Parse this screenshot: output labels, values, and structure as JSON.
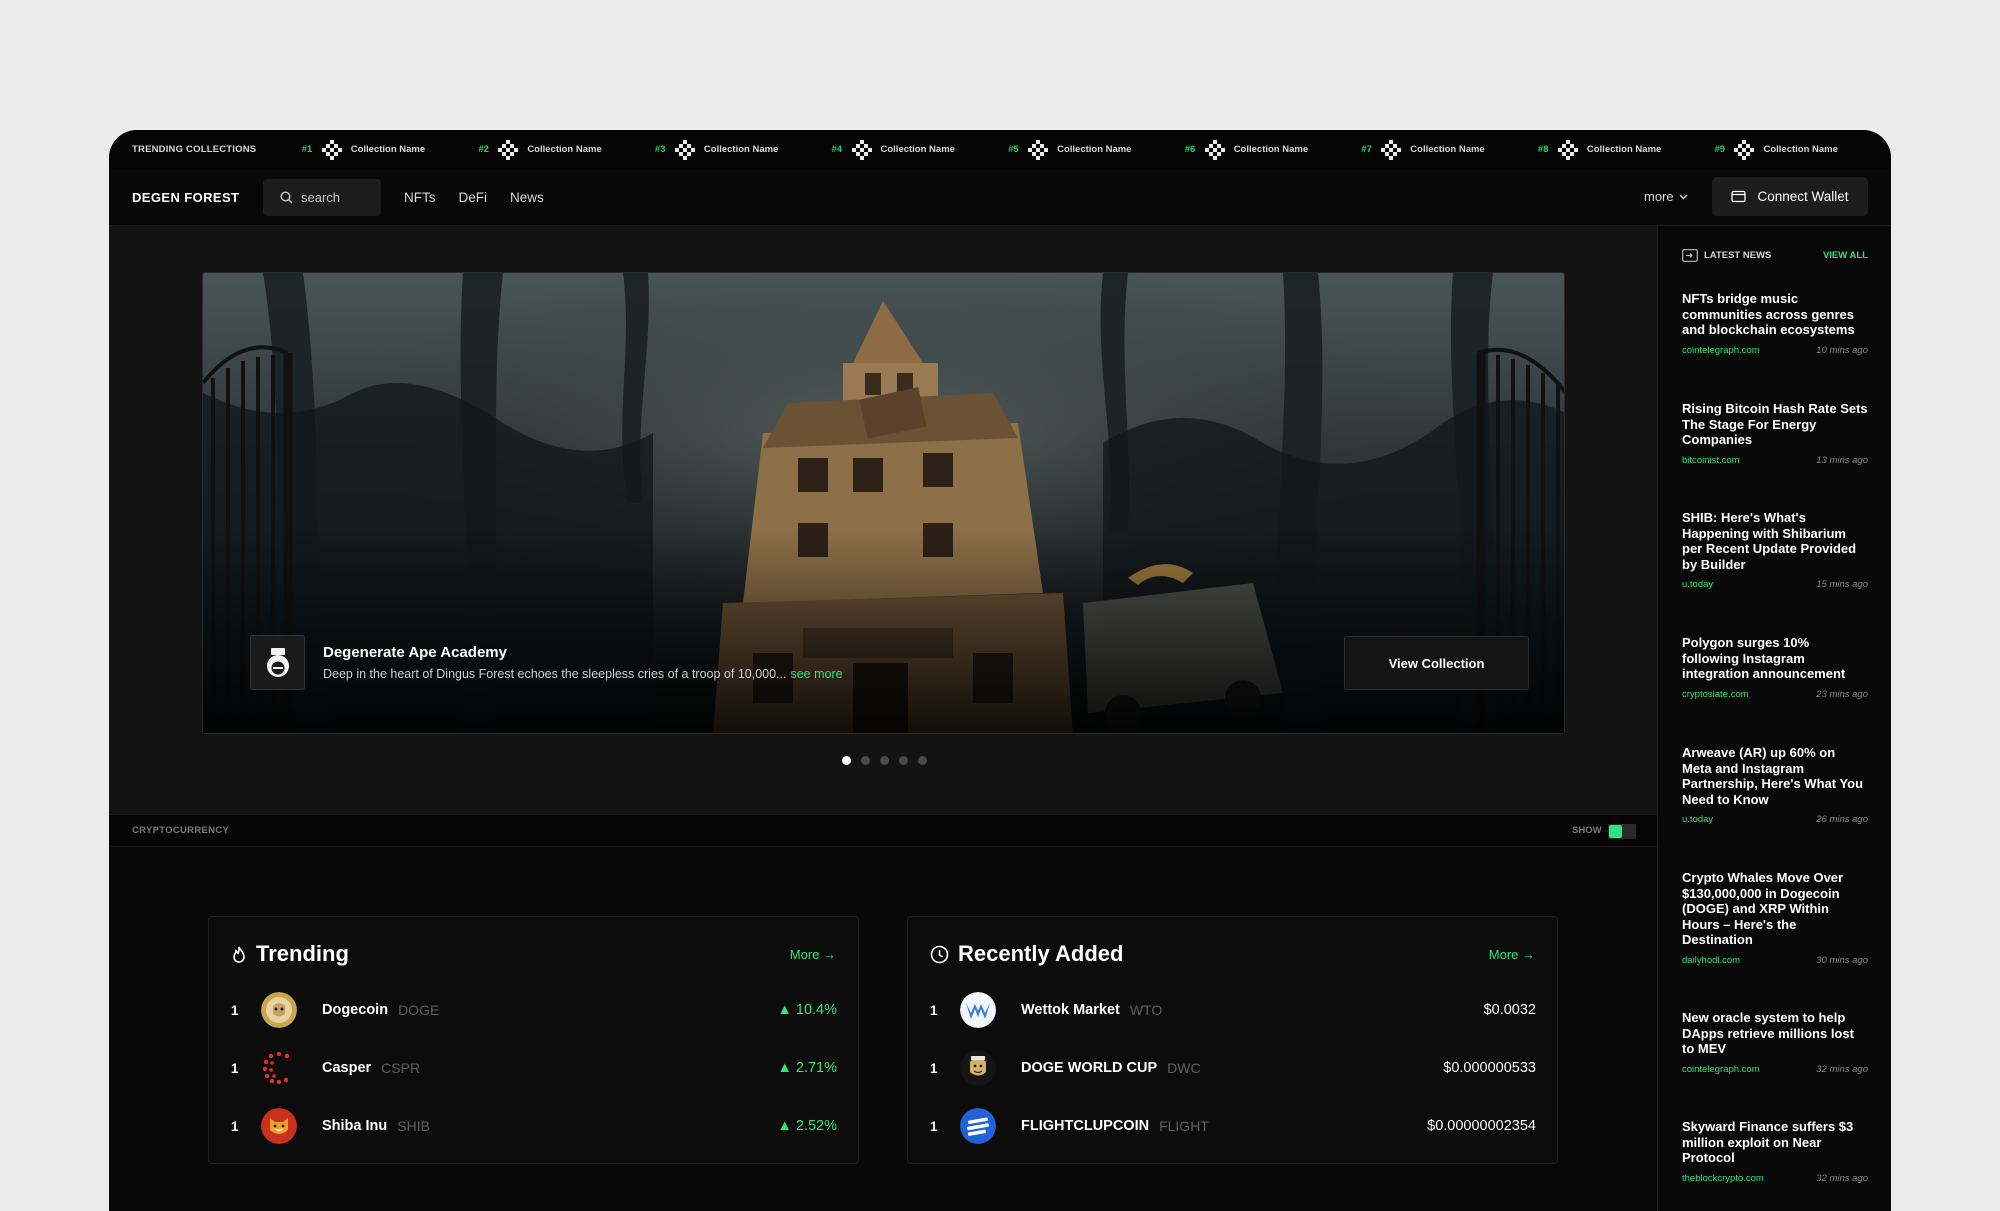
{
  "ticker": {
    "title": "TRENDING COLLECTIONS",
    "items": [
      {
        "rank": "#1",
        "name": "Collection Name"
      },
      {
        "rank": "#2",
        "name": "Collection Name"
      },
      {
        "rank": "#3",
        "name": "Collection Name"
      },
      {
        "rank": "#4",
        "name": "Collection Name"
      },
      {
        "rank": "#5",
        "name": "Collection Name"
      },
      {
        "rank": "#6",
        "name": "Collection Name"
      },
      {
        "rank": "#7",
        "name": "Collection Name"
      },
      {
        "rank": "#8",
        "name": "Collection Name"
      },
      {
        "rank": "#9",
        "name": "Collection Name"
      }
    ]
  },
  "nav": {
    "brand": "DEGEN FOREST",
    "search_placeholder": "search",
    "links": [
      "NFTs",
      "DeFi",
      "News"
    ],
    "more": "more",
    "wallet": "Connect Wallet"
  },
  "hero": {
    "title": "Degenerate Ape Academy",
    "description": "Deep in the heart of Dingus Forest echoes the sleepless cries of a troop of 10,000...",
    "see_more": "see more",
    "button": "View Collection",
    "slides": 5,
    "active_slide": 1
  },
  "crypto_bar": {
    "label": "CRYPTOCURRENCY",
    "show_label": "SHOW",
    "show_enabled": true
  },
  "trending": {
    "title": "Trending",
    "more": "More →",
    "rows": [
      {
        "rank": "1",
        "name": "Dogecoin",
        "symbol": "DOGE",
        "change": "▲ 10.4%"
      },
      {
        "rank": "1",
        "name": "Casper",
        "symbol": "CSPR",
        "change": "▲ 2.71%"
      },
      {
        "rank": "1",
        "name": "Shiba Inu",
        "symbol": "SHIB",
        "change": "▲ 2.52%"
      }
    ]
  },
  "recent": {
    "title": "Recently Added",
    "more": "More →",
    "rows": [
      {
        "rank": "1",
        "name": "Wettok Market",
        "symbol": "WTO",
        "price": "$0.0032"
      },
      {
        "rank": "1",
        "name": "DOGE WORLD CUP",
        "symbol": "DWC",
        "price": "$0.000000533"
      },
      {
        "rank": "1",
        "name": "FLIGHTCLUPCOIN",
        "symbol": "FLIGHT",
        "price": "$0.00000002354"
      }
    ]
  },
  "news": {
    "header": "LATEST NEWS",
    "view_all": "VIEW ALL",
    "items": [
      {
        "title": "NFTs bridge music communities across genres and blockchain ecosystems",
        "source": "cointelegraph.com",
        "time": "10 mins ago"
      },
      {
        "title": "Rising Bitcoin Hash Rate Sets The Stage For Energy Companies",
        "source": "bitcoinist.com",
        "time": "13 mins ago"
      },
      {
        "title": "SHIB: Here's What's Happening with Shibarium per Recent Update Provided by Builder",
        "source": "u.today",
        "time": "15 mins ago"
      },
      {
        "title": "Polygon surges 10% following Instagram integration announcement",
        "source": "cryptoslate.com",
        "time": "23 mins ago"
      },
      {
        "title": "Arweave (AR) up 60% on Meta and Instagram Partnership, Here's What You Need to Know",
        "source": "u.today",
        "time": "26 mins ago"
      },
      {
        "title": "Crypto Whales Move Over $130,000,000 in Dogecoin (DOGE) and XRP Within Hours – Here's the Destination",
        "source": "dailyhodl.com",
        "time": "30 mins ago"
      },
      {
        "title": "New oracle system to help DApps retrieve millions lost to MEV",
        "source": "cointelegraph.com",
        "time": "32 mins ago"
      },
      {
        "title": "Skyward Finance suffers $3 million exploit on Near Protocol",
        "source": "theblockcrypto.com",
        "time": "32 mins ago"
      }
    ]
  },
  "colors": {
    "accent": "#2ee57a",
    "background": "#0a0a0a",
    "page": "#ececec"
  }
}
